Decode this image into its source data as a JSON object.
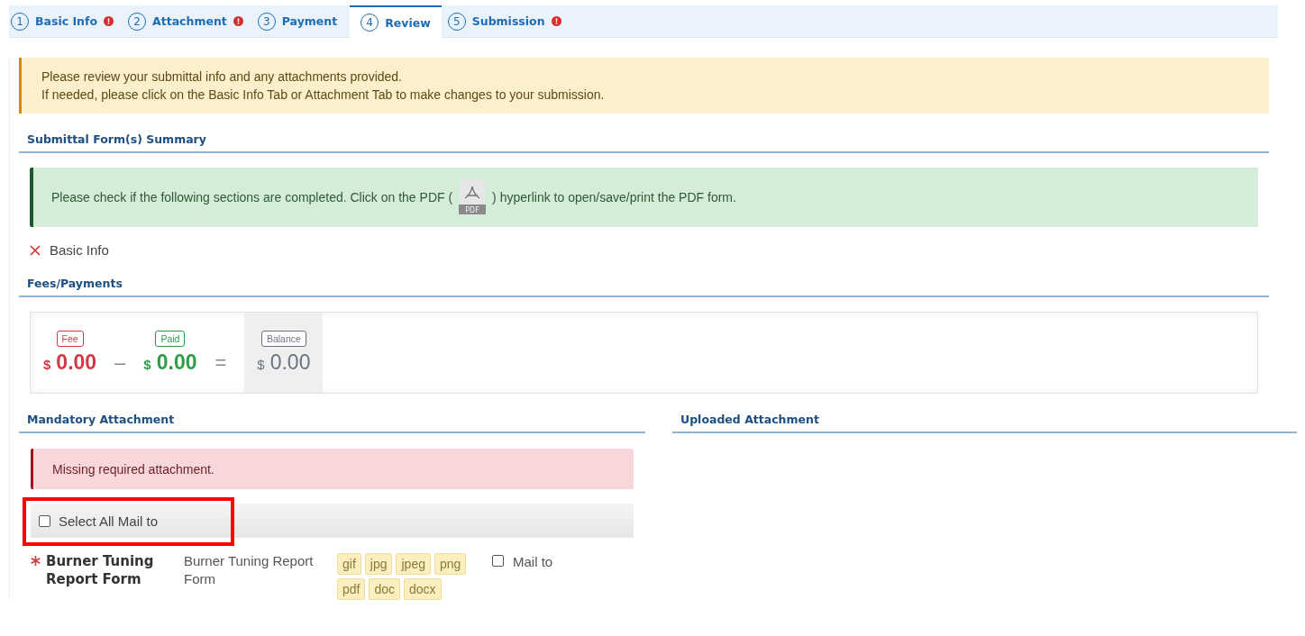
{
  "tabs": [
    {
      "number": "1",
      "label": "Basic Info",
      "selected": false,
      "error": true
    },
    {
      "number": "2",
      "label": "Attachment",
      "selected": false,
      "error": true
    },
    {
      "number": "3",
      "label": "Payment",
      "selected": false,
      "error": false
    },
    {
      "number": "4",
      "label": "Review",
      "selected": true,
      "error": false
    },
    {
      "number": "5",
      "label": "Submission",
      "selected": false,
      "error": true
    }
  ],
  "notice": {
    "lines": [
      "Please review your submittal info and any attachments provided.",
      "If needed, please click on the Basic Info Tab or Attachment Tab to make changes to your submission."
    ]
  },
  "summary": {
    "heading": "Submittal Form(s) Summary",
    "alert_before": "Please check if the following sections are completed. Click on the PDF (",
    "pdf_icon_label": "PDF",
    "alert_after": ") hyperlink to open/save/print the PDF form.",
    "sections": [
      {
        "label": "Basic Info",
        "completed": false
      }
    ]
  },
  "fees": {
    "heading": "Fees/Payments",
    "items": [
      {
        "kind": "fee",
        "label": "Fee",
        "currency": "$",
        "amount": "0.00"
      },
      {
        "kind": "operator",
        "symbol": "–"
      },
      {
        "kind": "paid",
        "label": "Paid",
        "currency": "$",
        "amount": "0.00"
      },
      {
        "kind": "operator",
        "symbol": "="
      },
      {
        "kind": "balance",
        "label": "Balance",
        "currency": "$",
        "amount": "0.00"
      }
    ]
  },
  "mandatory": {
    "heading": "Mandatory Attachment",
    "alert": "Missing required attachment.",
    "select_all": {
      "label": "Select All Mail to",
      "checked": false,
      "highlighted": true
    },
    "attachments": [
      {
        "name": "Burner Tuning Report Form",
        "required": true,
        "description": "Burner Tuning Report Form",
        "types": [
          "gif",
          "jpg",
          "jpeg",
          "png",
          "pdf",
          "doc",
          "docx"
        ],
        "mail_to": {
          "label": "Mail to",
          "checked": false
        }
      }
    ]
  },
  "uploaded": {
    "heading": "Uploaded Attachment"
  }
}
